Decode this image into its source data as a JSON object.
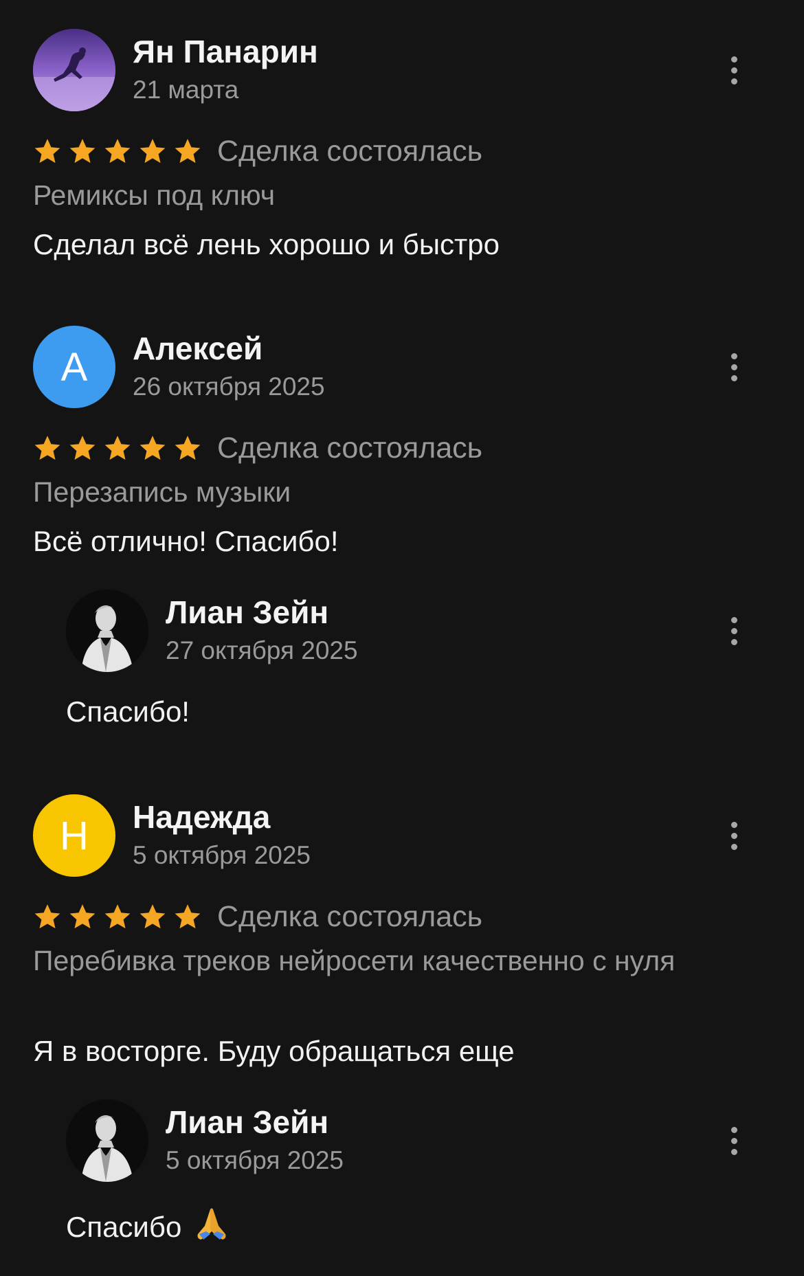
{
  "colors": {
    "background": "#141414",
    "star": "#F5A623",
    "avatar_a": "#3D9BF0",
    "avatar_n": "#F8C600",
    "secondary_text": "#9A9A9A"
  },
  "reviews": [
    {
      "author": "Ян Панарин",
      "date": "21 марта",
      "avatar_icon": "skater-photo-avatar",
      "rating": 5,
      "deal_status": "Сделка состоялась",
      "service": "Ремиксы под ключ",
      "text": "Сделал всё лень хорошо и быстро"
    },
    {
      "author": "Алексей",
      "date": "26 октября 2025",
      "avatar_letter": "А",
      "rating": 5,
      "deal_status": "Сделка состоялась",
      "service": "Перезапись музыки",
      "text": "Всё отлично! Спасибо!",
      "reply": {
        "author": "Лиан Зейн",
        "date": "27 октября 2025",
        "avatar_icon": "portrait-photo-avatar",
        "text": "Спасибо!"
      }
    },
    {
      "author": "Надежда",
      "date": "5 октября 2025",
      "avatar_letter": "Н",
      "rating": 5,
      "deal_status": "Сделка состоялась",
      "service": "Перебивка треков нейросети качественно с нуля",
      "text": "Я в восторге. Буду обращаться еще",
      "reply": {
        "author": "Лиан Зейн",
        "date": "5 октября 2025",
        "avatar_icon": "portrait-photo-avatar",
        "text": "Спасибо",
        "emoji": "folded-hands-icon"
      }
    }
  ]
}
